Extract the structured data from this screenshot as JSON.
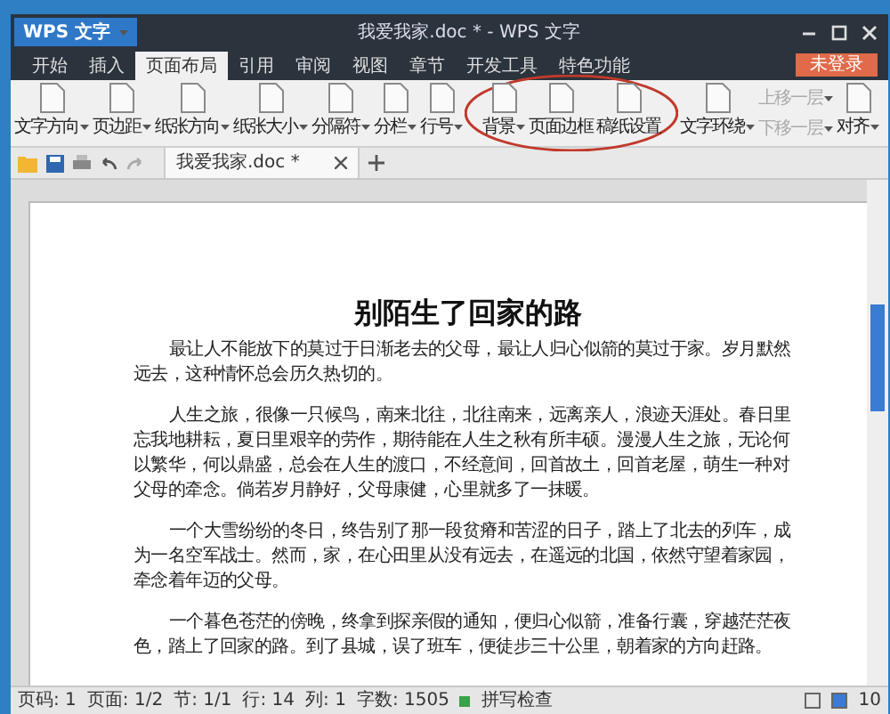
{
  "window": {
    "app_button": "WPS 文字",
    "title": "我爱我家.doc * - WPS 文字"
  },
  "menu_tabs": [
    {
      "label": "开始",
      "selected": false
    },
    {
      "label": "插入",
      "selected": false
    },
    {
      "label": "页面布局",
      "selected": true
    },
    {
      "label": "引用",
      "selected": false
    },
    {
      "label": "审阅",
      "selected": false
    },
    {
      "label": "视图",
      "selected": false
    },
    {
      "label": "章节",
      "selected": false
    },
    {
      "label": "开发工具",
      "selected": false
    },
    {
      "label": "特色功能",
      "selected": false
    }
  ],
  "login_button": "未登录",
  "ribbon": [
    {
      "label": "文字方向",
      "kind": "large",
      "dropdown": true,
      "disabled": false
    },
    {
      "label": "页边距",
      "kind": "large",
      "dropdown": true,
      "disabled": false
    },
    {
      "label": "纸张方向",
      "kind": "large",
      "dropdown": true,
      "disabled": false
    },
    {
      "label": "纸张大小",
      "kind": "large",
      "dropdown": true,
      "disabled": false
    },
    {
      "label": "分隔符",
      "kind": "large",
      "dropdown": true,
      "disabled": false
    },
    {
      "label": "分栏",
      "kind": "large",
      "dropdown": true,
      "disabled": false
    },
    {
      "label": "行号",
      "kind": "large",
      "dropdown": true,
      "disabled": false
    },
    {
      "label": "背景",
      "kind": "large",
      "dropdown": true,
      "disabled": false,
      "circled": true
    },
    {
      "label": "页面边框",
      "kind": "large",
      "dropdown": false,
      "disabled": false,
      "circled": true
    },
    {
      "label": "稿纸设置",
      "kind": "large",
      "dropdown": false,
      "disabled": false,
      "circled": true
    },
    {
      "label": "文字环绕",
      "kind": "large",
      "dropdown": true,
      "disabled": false
    },
    {
      "label": "上移一层",
      "kind": "small",
      "dropdown": true,
      "disabled": true
    },
    {
      "label": "下移一层",
      "kind": "small",
      "dropdown": true,
      "disabled": true
    },
    {
      "label": "对齐",
      "kind": "large",
      "dropdown": true,
      "disabled": false
    }
  ],
  "document_tab": {
    "label": "我爱我家.doc *"
  },
  "document": {
    "title": "别陌生了回家的路",
    "paragraphs": [
      "最让人不能放下的莫过于日渐老去的父母，最让人归心似箭的莫过于家。岁月默然远去，这种情怀总会历久热切的。",
      "人生之旅，很像一只候鸟，南来北往，北往南来，远离亲人，浪迹天涯处。春日里忘我地耕耘，夏日里艰辛的劳作，期待能在人生之秋有所丰硕。漫漫人生之旅，无论何以繁华，何以鼎盛，总会在人生的渡口，不经意间，回首故土，回首老屋，萌生一种对父母的牵念。倘若岁月静好，父母康健，心里就多了一抹暖。",
      "一个大雪纷纷的冬日，终告别了那一段贫瘠和苦涩的日子，踏上了北去的列车，成为一名空军战士。然而，家，在心田里从没有远去，在遥远的北国，依然守望着家园，牵念着年迈的父母。",
      "一个暮色苍茫的傍晚，终拿到探亲假的通知，便归心似箭，准备行囊，穿越茫茫夜色，踏上了回家的路。到了县城，误了班车，便徒步三十公里，朝着家的方向赶路。"
    ]
  },
  "status_bar": {
    "items": [
      "页码: 1",
      "页面: 1/2",
      "节: 1/1",
      "行: 14",
      "列: 1",
      "字数: 1505"
    ],
    "spell_check": "拼写检查",
    "zoom": "10"
  }
}
